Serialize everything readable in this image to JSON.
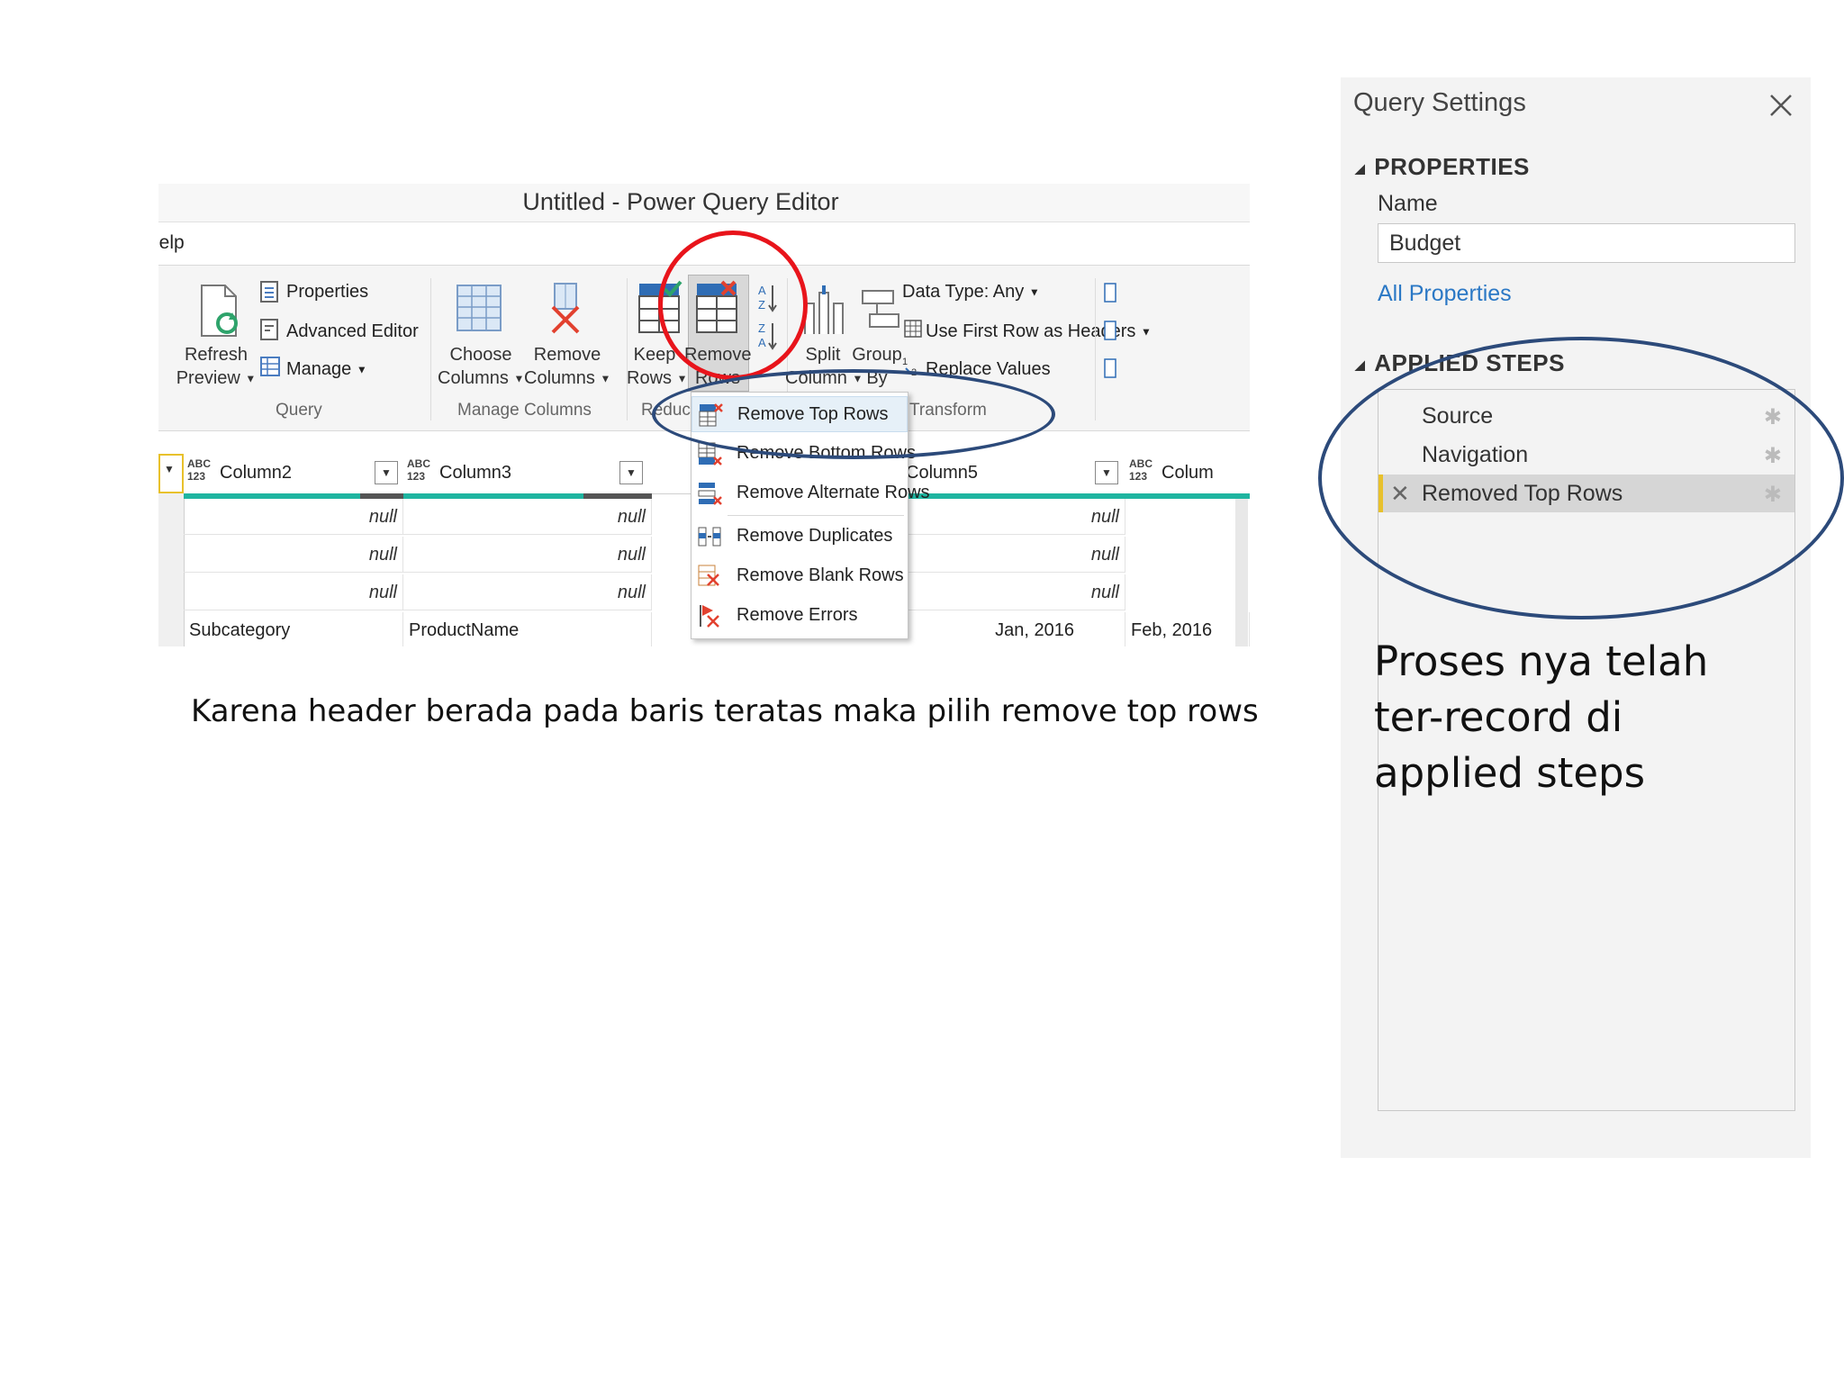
{
  "editor": {
    "title": "Untitled - Power Query Editor",
    "menu_tab": "lelp",
    "ribbon": {
      "refresh_preview": [
        "Refresh",
        "Preview"
      ],
      "properties": "Properties",
      "advanced_editor": "Advanced Editor",
      "manage": "Manage",
      "group_query": "Query",
      "choose_columns": [
        "Choose",
        "Columns"
      ],
      "remove_columns": [
        "Remove",
        "Columns"
      ],
      "group_manage_columns": "Manage Columns",
      "keep_rows": [
        "Keep",
        "Rows"
      ],
      "remove_rows": [
        "Remove",
        "Rows"
      ],
      "group_reduce": "Reduc",
      "split_column": [
        "Split",
        "Column"
      ],
      "group_by": [
        "Group",
        "By"
      ],
      "data_type": "Data Type: Any",
      "use_first_row": "Use First Row as Headers",
      "replace_values": "Replace Values",
      "group_transform": "Transform"
    },
    "grid": {
      "type_label": [
        "ABC",
        "123"
      ],
      "columns": [
        "Column2",
        "Column3",
        "Column5",
        "Colum"
      ],
      "null_text": "null",
      "last_row": [
        "Subcategory",
        "ProductName",
        "Jan, 2016",
        "Feb, 2016"
      ]
    },
    "dropdown": [
      {
        "label": "Remove Top Rows",
        "icon": "remove-top-rows-icon"
      },
      {
        "label": "Remove Bottom Rows",
        "icon": "remove-bottom-rows-icon"
      },
      {
        "label": "Remove Alternate Rows",
        "icon": "remove-alternate-rows-icon"
      },
      {
        "label": "Remove Duplicates",
        "icon": "remove-duplicates-icon"
      },
      {
        "label": "Remove Blank Rows",
        "icon": "remove-blank-rows-icon"
      },
      {
        "label": "Remove Errors",
        "icon": "remove-errors-icon"
      }
    ]
  },
  "caption": "Karena header berada pada baris teratas maka pilih remove top rows",
  "query_settings": {
    "title": "Query Settings",
    "properties_heading": "PROPERTIES",
    "name_label": "Name",
    "name_value": "Budget",
    "all_properties": "All Properties",
    "applied_steps_heading": "APPLIED STEPS",
    "steps": [
      "Source",
      "Navigation",
      "Removed Top Rows"
    ],
    "note": "Proses nya telah ter-record di applied steps"
  },
  "colors": {
    "accent_teal": "#1fb5a0",
    "annotation_red": "#e8141b",
    "annotation_blue": "#2c4a7a",
    "link_blue": "#2b78c5",
    "selected_step_marker": "#e8c12c"
  }
}
